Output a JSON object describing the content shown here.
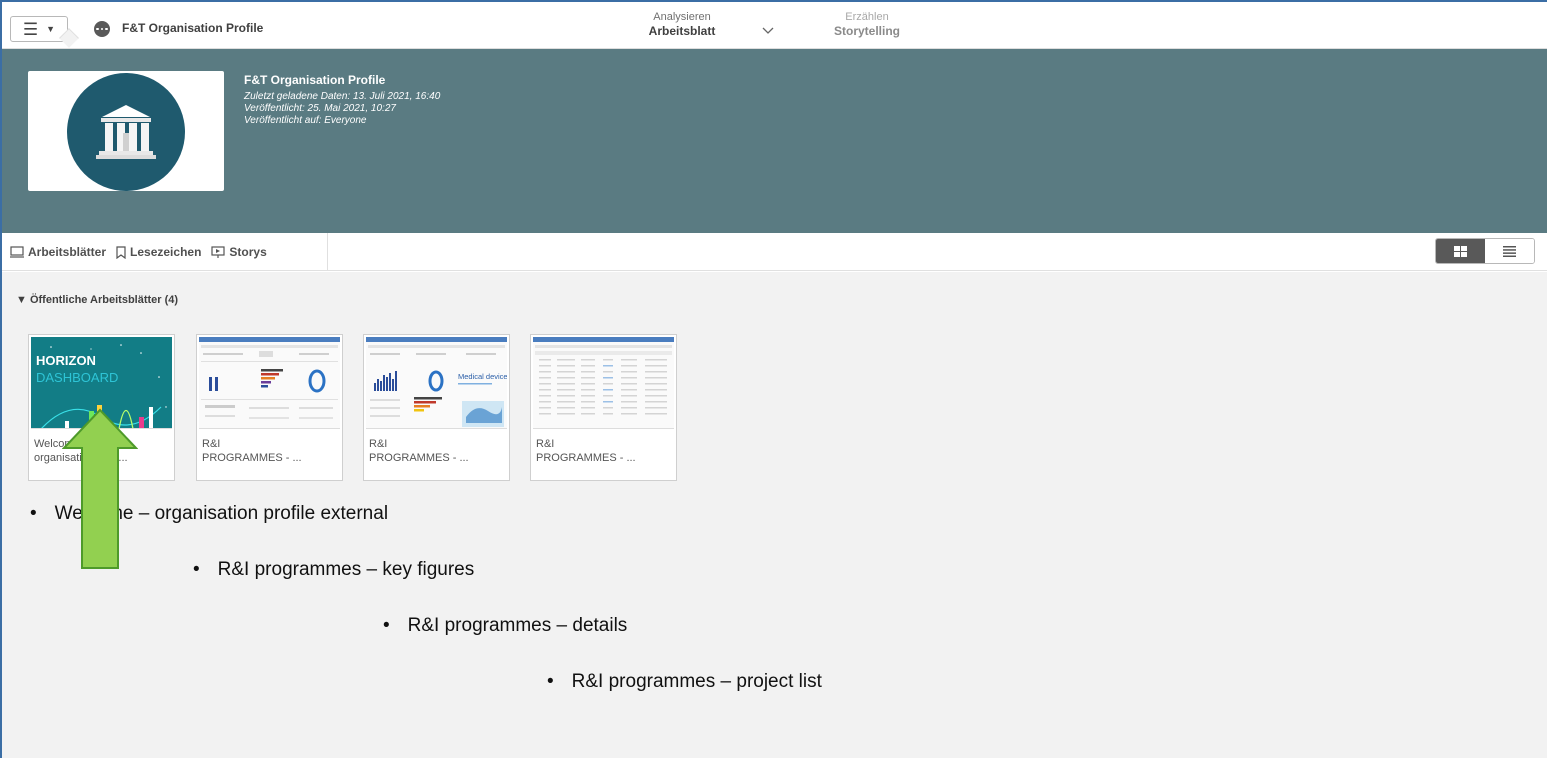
{
  "topbar": {
    "app_title": "F&T Organisation Profile",
    "nav": {
      "analyse_small": "Analysieren",
      "analyse_big": "Arbeitsblatt",
      "story_small": "Erzählen",
      "story_big": "Storytelling"
    }
  },
  "header": {
    "title": "F&T Organisation Profile",
    "lines": [
      "Zuletzt geladene Daten: 13. Juli 2021, 16:40",
      "Veröffentlicht: 25. Mai 2021, 10:27",
      "Veröffentlicht auf: Everyone"
    ]
  },
  "tabs": [
    {
      "label": "Arbeitsblätter",
      "icon": "sheet-icon"
    },
    {
      "label": "Lesezeichen",
      "icon": "bookmark-icon"
    },
    {
      "label": "Storys",
      "icon": "story-icon"
    }
  ],
  "section": {
    "title": "Öffentliche Arbeitsblätter (4)"
  },
  "sheets": [
    {
      "line1": "Welcome –",
      "line2": "organisation profi..."
    },
    {
      "line1": "R&I",
      "line2": "PROGRAMMES - ..."
    },
    {
      "line1": "R&I",
      "line2": "PROGRAMMES - ..."
    },
    {
      "line1": "R&I",
      "line2": "PROGRAMMES - ..."
    }
  ],
  "thumbnail_texts": {
    "horizon_line1": "HORIZON",
    "horizon_line2": "DASHBOARD",
    "medical_devices": "Medical devices"
  },
  "annotations": {
    "bullet_symbol": "•",
    "items": [
      "Welcome – organisation profile external",
      "R&I programmes – key figures",
      "R&I programmes – details",
      "R&I programmes – project list"
    ]
  },
  "colors": {
    "header_band": "#5a7b82",
    "logo_circle": "#1f5a6e",
    "arrow_fill": "#92d050",
    "arrow_stroke": "#4e9a2a",
    "content_bg": "#f2f2f2"
  }
}
